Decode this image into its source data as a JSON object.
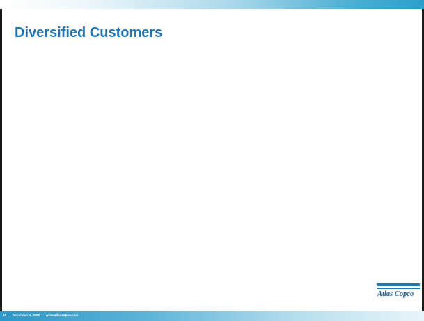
{
  "slide": {
    "title": "Diversified Customers",
    "logo_text": "Atlas Copco",
    "footer": {
      "page_number": "25",
      "date": "December 4, 2008",
      "website": "www.atlascopco.com"
    }
  },
  "colors": {
    "title": "#1d74b7",
    "accent_blue": "#2a9fca",
    "logo_blue": "#1f79b9"
  }
}
